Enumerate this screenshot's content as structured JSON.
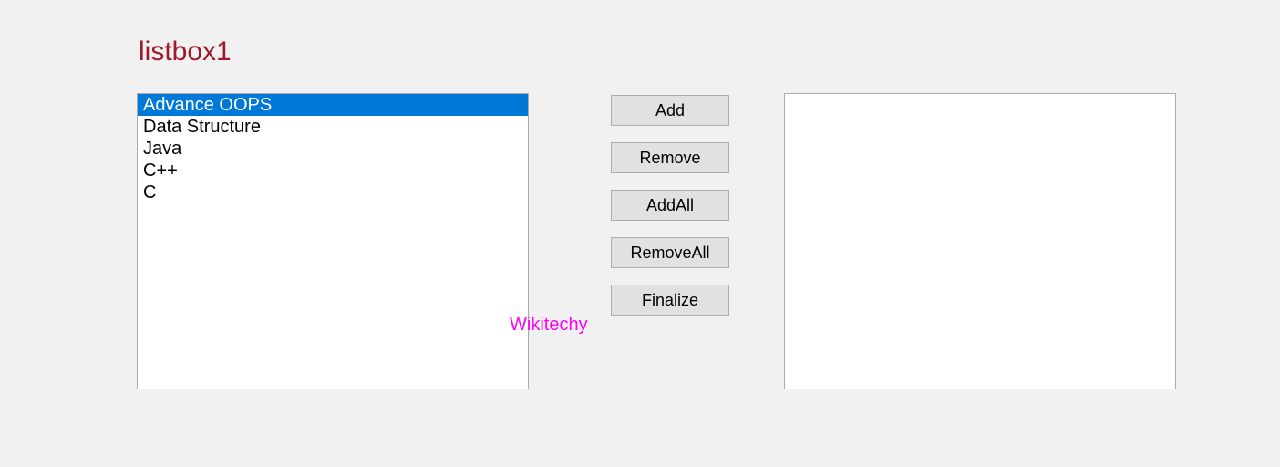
{
  "title": "listbox1",
  "listbox1": {
    "items": [
      {
        "label": "Advance OOPS",
        "selected": true
      },
      {
        "label": "Data Structure",
        "selected": false
      },
      {
        "label": "Java",
        "selected": false
      },
      {
        "label": "C++",
        "selected": false
      },
      {
        "label": "C",
        "selected": false
      }
    ]
  },
  "listbox2": {
    "items": []
  },
  "buttons": {
    "add": "Add",
    "remove": "Remove",
    "addAll": "AddAll",
    "removeAll": "RemoveAll",
    "finalize": "Finalize"
  },
  "watermark": "Wikitechy"
}
